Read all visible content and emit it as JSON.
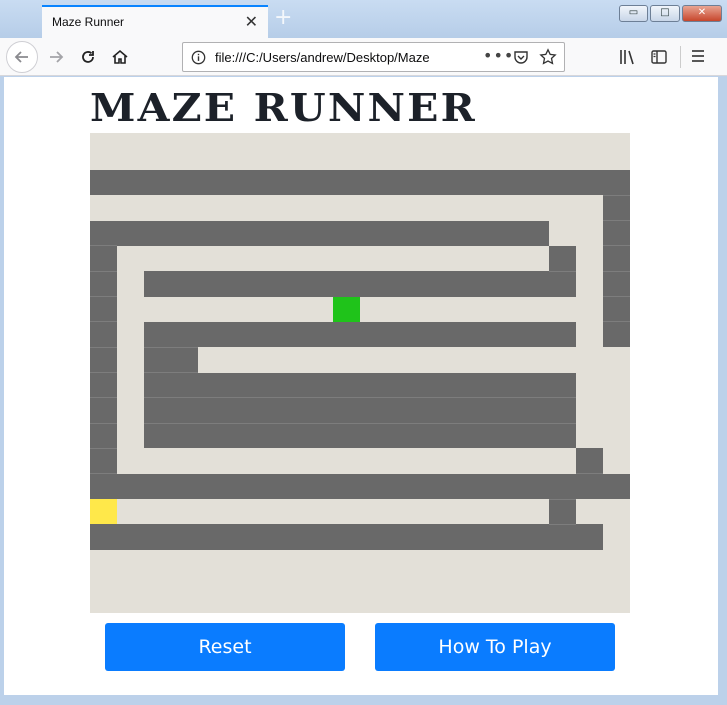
{
  "browser": {
    "tab_title": "Maze Runner",
    "tab_close": "✕",
    "new_tab": "+",
    "url": "file:///C:/Users/andrew/Desktop/Maze",
    "url_more": "•••",
    "window_min": "▭",
    "window_max": "□",
    "window_close": "✕"
  },
  "page": {
    "title": "MAZE RUNNER"
  },
  "buttons": {
    "reset": "Reset",
    "how_to_play": "How To Play"
  },
  "colors": {
    "wall": "#696969",
    "path": "#e3e0d8",
    "player": "#ffe84a",
    "goal": "#1fc31a",
    "button": "#0a7cff"
  },
  "maze": {
    "cols": 20,
    "rows": 18,
    "grid": [
      "....................",
      "####################",
      "...................#",
      "#################..#",
      "#................#.#",
      "#.################.#",
      "#........G.........#",
      "#.################.#",
      "#.##...............",
      "#.################..",
      "#.################..",
      "#.################..",
      "#.................#.",
      "####################",
      "P................#..",
      "###################.",
      "....................",
      "...................."
    ]
  }
}
